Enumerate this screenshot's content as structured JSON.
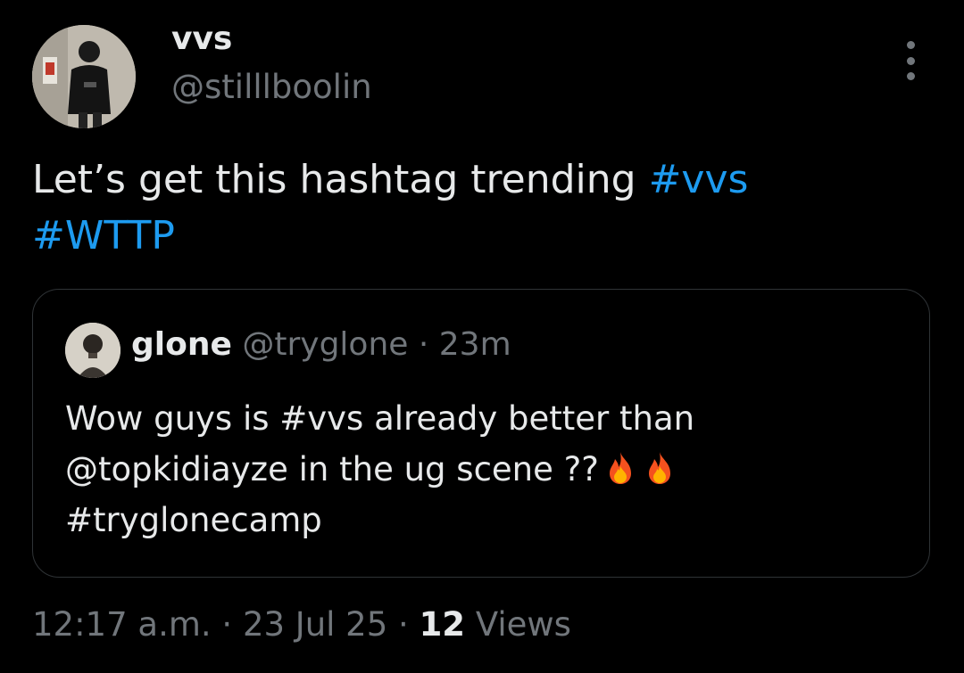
{
  "author": {
    "display_name": "vvs",
    "handle": "@stilllboolin",
    "avatar_icon": "user-avatar-photo"
  },
  "tweet": {
    "text_prefix": "Let’s get this hashtag trending ",
    "hashtag_1": "#vvs",
    "hashtag_2": "#WTTP"
  },
  "quote": {
    "display_name": "glone",
    "handle": "@tryglone",
    "separator": "·",
    "time": "23m",
    "line_1": "Wow guys is #vvs already better than",
    "line_2": "@topkidiayze in the ug scene ??",
    "line_3": "#tryglonecamp",
    "emoji": "fire-emoji"
  },
  "meta": {
    "time": "12:17 a.m.",
    "separator": "·",
    "date": "23 Jul 25",
    "views_count": "12",
    "views_label": "Views"
  },
  "colors": {
    "background": "#000000",
    "text": "#e7e9ea",
    "muted": "#71767b",
    "accent": "#1d9bf0",
    "border": "#2f3336"
  }
}
